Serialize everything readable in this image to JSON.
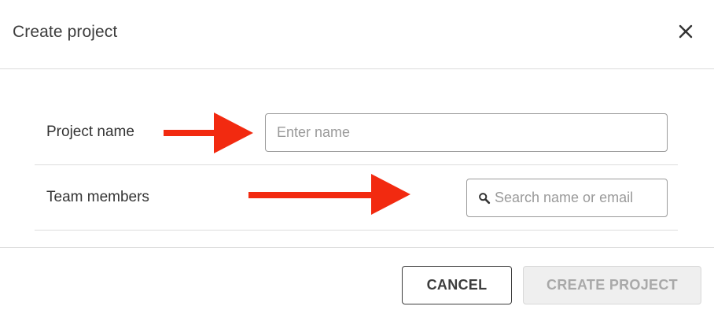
{
  "dialog": {
    "title": "Create project",
    "close_icon": "close-icon"
  },
  "fields": {
    "project_name": {
      "label": "Project name",
      "value": "",
      "placeholder": "Enter name"
    },
    "team_members": {
      "label": "Team members",
      "value": "",
      "placeholder": "Search name or email",
      "icon": "search-icon"
    }
  },
  "annotations": {
    "arrow_color": "#f22a10"
  },
  "footer": {
    "cancel_label": "CANCEL",
    "create_label": "CREATE PROJECT",
    "create_enabled": false
  }
}
